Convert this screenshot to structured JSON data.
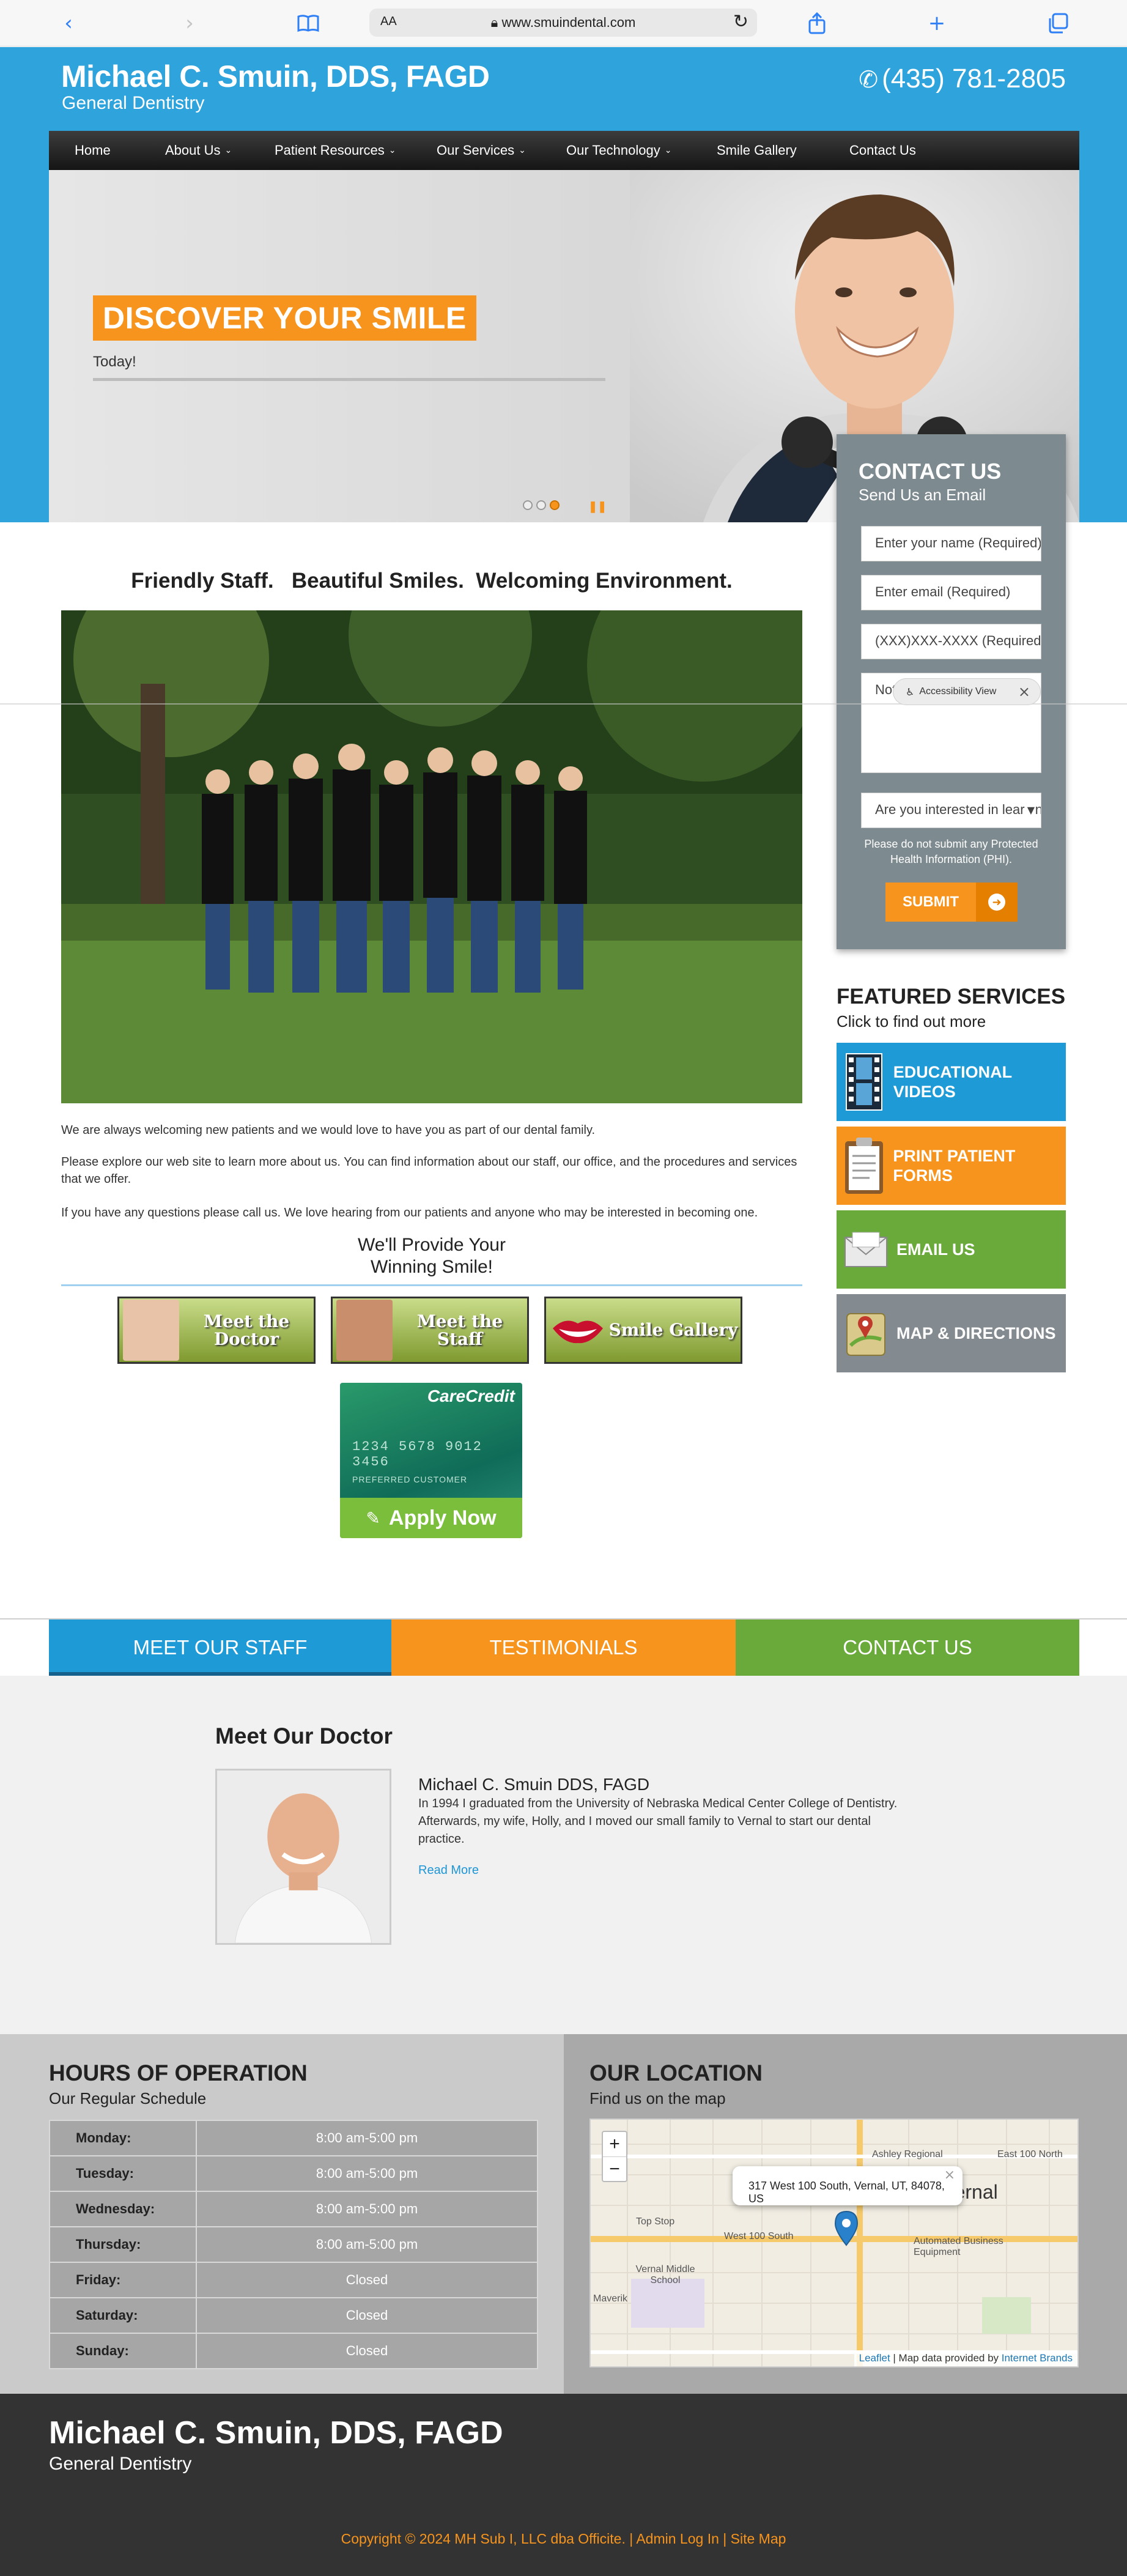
{
  "browser": {
    "aa_label": "AA",
    "url": "www.smuindental.com"
  },
  "header": {
    "title": "Michael C. Smuin, DDS, FAGD",
    "subtitle": "General Dentistry",
    "phone": "(435) 781-2805"
  },
  "nav": [
    {
      "label": "Home",
      "dropdown": false
    },
    {
      "label": "About Us",
      "dropdown": true
    },
    {
      "label": "Patient Resources",
      "dropdown": true
    },
    {
      "label": "Our Services",
      "dropdown": true
    },
    {
      "label": "Our Technology",
      "dropdown": true
    },
    {
      "label": "Smile Gallery",
      "dropdown": false
    },
    {
      "label": "Contact Us",
      "dropdown": false
    }
  ],
  "hero": {
    "title": "DISCOVER YOUR SMILE",
    "subtitle": "Today!",
    "active_slide": 3,
    "slide_count": 3
  },
  "contact_form": {
    "title": "CONTACT US",
    "subtitle": "Send Us an Email",
    "name_placeholder": "Enter your name (Required)",
    "email_placeholder": "Enter email (Required)",
    "phone_placeholder": "(XXX)XXX-XXXX (Required)",
    "notes_placeholder": "Notes",
    "interest_select": "Are you interested in learning more",
    "note": "Please do not submit any Protected Health Information (PHI).",
    "submit_label": "SUBMIT"
  },
  "accessibility": {
    "label": "Accessibility View"
  },
  "main": {
    "heading": "Friendly Staff.   Beautiful Smiles.  Welcoming Environment.",
    "paragraphs": [
      "We are always welcoming new patients and we would love to have you as part of our dental family.",
      "Please explore our web site to learn more about us.  You can find information about our staff, our office, and the procedures and services that we offer.",
      "If you have any questions please call us.  We love hearing from our patients and anyone who may be interested in becoming one."
    ],
    "provide_line1": "We'll Provide Your",
    "provide_line2": "Winning Smile!",
    "buttons": [
      "Meet the Doctor",
      "Meet the Staff",
      "Smile Gallery"
    ]
  },
  "care_credit": {
    "brand": "CareCredit",
    "card_number": "1234 5678 9012 3456",
    "card_label": "PREFERRED CUSTOMER",
    "apply_label": "Apply Now"
  },
  "featured": {
    "title": "FEATURED SERVICES",
    "subtitle": "Click to find out more",
    "tiles": [
      {
        "label": "EDUCATIONAL VIDEOS",
        "color": "#1e9bd7",
        "icon": "film-icon"
      },
      {
        "label": "PRINT PATIENT FORMS",
        "color": "#f7941d",
        "icon": "clipboard-icon"
      },
      {
        "label": "EMAIL US",
        "color": "#6aaa3a",
        "icon": "envelope-icon"
      },
      {
        "label": "MAP & DIRECTIONS",
        "color": "#848b90",
        "icon": "map-pin-icon"
      }
    ]
  },
  "tabs": [
    {
      "label": "MEET OUR STAFF",
      "color": "#1e9bd7"
    },
    {
      "label": "TESTIMONIALS",
      "color": "#f7941d"
    },
    {
      "label": "CONTACT US",
      "color": "#6aaa3a"
    }
  ],
  "doctor": {
    "heading": "Meet Our Doctor",
    "name": "Michael C. Smuin DDS, FAGD",
    "bio": "In 1994 I graduated from the University of Nebraska Medical Center College of Dentistry. Afterwards, my wife, Holly, and I moved our small family to Vernal to start our dental practice.",
    "read_more": "Read More"
  },
  "hours": {
    "title": "HOURS OF OPERATION",
    "subtitle": "Our Regular Schedule",
    "rows": [
      {
        "day": "Monday:",
        "time": "8:00 am-5:00 pm"
      },
      {
        "day": "Tuesday:",
        "time": "8:00 am-5:00 pm"
      },
      {
        "day": "Wednesday:",
        "time": "8:00 am-5:00 pm"
      },
      {
        "day": "Thursday:",
        "time": "8:00 am-5:00 pm"
      },
      {
        "day": "Friday:",
        "time": "Closed"
      },
      {
        "day": "Saturday:",
        "time": "Closed"
      },
      {
        "day": "Sunday:",
        "time": "Closed"
      }
    ]
  },
  "location": {
    "title": "OUR LOCATION",
    "subtitle": "Find us on the map",
    "popup": "317 West 100 South, Vernal, UT, 84078, US",
    "zoom_in": "+",
    "zoom_out": "−",
    "labels": [
      "Ashley Regional",
      "East 100 North",
      "Vernal",
      "Top Stop",
      "West 100 South",
      "Automated Business Equipment",
      "Vernal Middle School",
      "Maverik"
    ],
    "attribution_link": "Leaflet",
    "attribution_text": " | Map data provided by ",
    "attribution_brand": "Internet Brands"
  },
  "footer": {
    "title": "Michael C. Smuin, DDS, FAGD",
    "subtitle": "General Dentistry",
    "copyright": "Copyright © 2024 MH Sub I, LLC dba Officite.",
    "admin_link": "Admin Log In",
    "sitemap_link": "Site Map"
  }
}
